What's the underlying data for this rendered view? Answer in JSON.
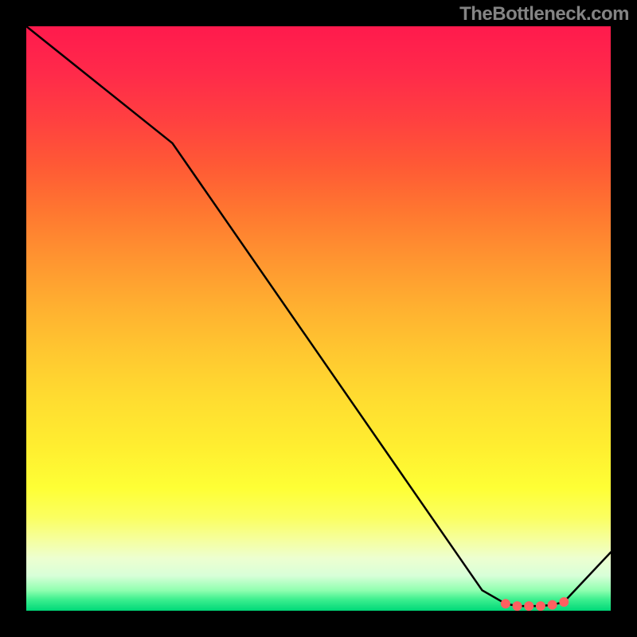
{
  "attribution": "TheBottleneck.com",
  "chart_data": {
    "type": "line",
    "title": "",
    "xlabel": "",
    "ylabel": "",
    "xlim": [
      0,
      100
    ],
    "ylim": [
      0,
      100
    ],
    "series": [
      {
        "name": "curve",
        "x": [
          0,
          25,
          78,
          82,
          84,
          86,
          88,
          90,
          92,
          100
        ],
        "y": [
          100,
          80,
          3.5,
          1.2,
          0.8,
          0.8,
          0.8,
          1.0,
          1.5,
          10
        ]
      }
    ],
    "markers": {
      "x": [
        82,
        84,
        86,
        88,
        90,
        92
      ],
      "y": [
        1.2,
        0.8,
        0.8,
        0.8,
        1.0,
        1.5
      ],
      "color": "#ff6060",
      "size": 6
    },
    "colors": {
      "line": "#000000",
      "background_top": "#ff1a4d",
      "background_bottom": "#00d878"
    }
  }
}
